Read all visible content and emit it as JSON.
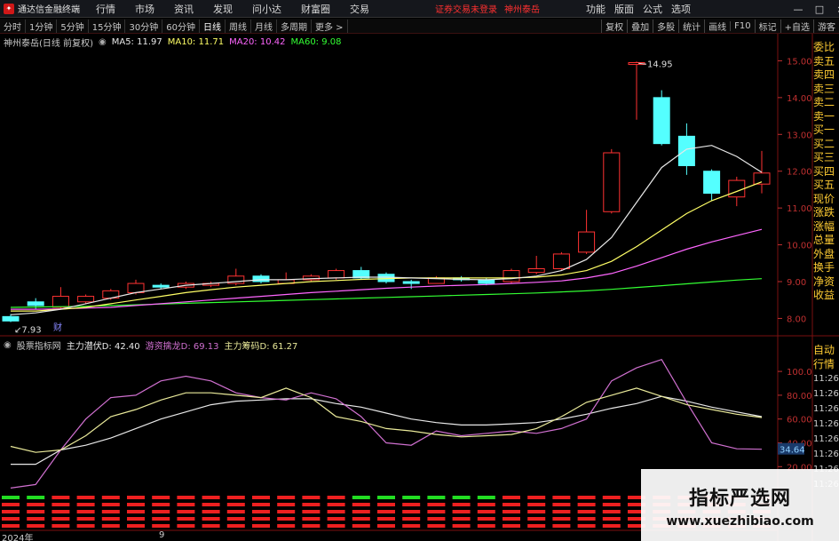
{
  "app": {
    "title": "通达信金融终端",
    "broker_status": "证券交易未登录",
    "stock_name": "神州泰岳"
  },
  "menu": [
    "行情",
    "市场",
    "资讯",
    "发现",
    "问小达",
    "财富圈",
    "交易"
  ],
  "right_menu": [
    "功能",
    "版面",
    "公式",
    "选项"
  ],
  "window_buttons": [
    "—",
    "□",
    "×"
  ],
  "corner_letter": "R",
  "periods": [
    "分时",
    "1分钟",
    "5分钟",
    "15分钟",
    "30分钟",
    "60分钟",
    "日线",
    "周线",
    "月线",
    "多周期",
    "更多 >"
  ],
  "active_period": "日线",
  "tools": [
    "复权",
    "叠加",
    "多股",
    "统计",
    "画线",
    "F10",
    "标记",
    "+自选",
    "游客"
  ],
  "kline_info": {
    "title": "神州泰岳(日线 前复权)",
    "ma5": "MA5: 11.97",
    "ma10": "MA10: 11.71",
    "ma20": "MA20: 10.42",
    "ma60": "MA60: 9.08"
  },
  "price_axis": [
    "15.00",
    "14.00",
    "13.00",
    "12.00",
    "11.00",
    "10.00",
    "9.00",
    "8.00"
  ],
  "high_label": "14.95",
  "low_label": "7.93",
  "finance_marker": "财",
  "indicator_info": {
    "title": "股票指标网",
    "line1": "主力潜伏D: 42.40",
    "line2": "游资擒龙D: 69.13",
    "line3": "主力筹码D: 61.27"
  },
  "indicator_axis": [
    "100.0",
    "80.00",
    "60.00",
    "40.00",
    "20.00"
  ],
  "indicator_current": "34.64",
  "sidebar": [
    "委比",
    "卖五",
    "卖四",
    "卖三",
    "卖二",
    "卖一",
    "买一",
    "买二",
    "买三",
    "买四",
    "买五",
    "现价",
    "涨跌",
    "涨幅",
    "总量",
    "外盘",
    "换手",
    "净资",
    "收益"
  ],
  "sidebar2": [
    "自动",
    "行情"
  ],
  "time_ticks": [
    "11:26",
    "11:26",
    "11:26",
    "11:26",
    "11:26",
    "11:26",
    "11:26",
    "11:26"
  ],
  "x_axis": {
    "year": "2024年",
    "month": "9"
  },
  "watermark": {
    "cn": "指标严选网",
    "url": "www.xuezhibiao.com"
  },
  "colors": {
    "up": "#ff3232",
    "down": "#54ffff",
    "ma5": "#e8e8e8",
    "ma10": "#ffff66",
    "ma20": "#ff66ff",
    "ma60": "#33ff33",
    "ind1": "#e8e8e8",
    "ind2": "#d070d0",
    "ind3": "#eaea9a"
  },
  "chart_data": [
    {
      "type": "candlestick",
      "ylim": [
        7.6,
        15.3
      ],
      "candles": [
        {
          "o": 8.05,
          "c": 7.93,
          "h": 8.12,
          "l": 7.9
        },
        {
          "o": 8.45,
          "c": 8.35,
          "h": 8.55,
          "l": 8.25
        },
        {
          "o": 8.3,
          "c": 8.6,
          "h": 8.85,
          "l": 8.25
        },
        {
          "o": 8.45,
          "c": 8.6,
          "h": 8.65,
          "l": 8.4
        },
        {
          "o": 8.55,
          "c": 8.75,
          "h": 8.8,
          "l": 8.5
        },
        {
          "o": 8.7,
          "c": 8.95,
          "h": 9.05,
          "l": 8.65
        },
        {
          "o": 8.9,
          "c": 8.85,
          "h": 8.95,
          "l": 8.8
        },
        {
          "o": 8.85,
          "c": 8.95,
          "h": 9.0,
          "l": 8.8
        },
        {
          "o": 8.9,
          "c": 8.95,
          "h": 9.0,
          "l": 8.85
        },
        {
          "o": 8.95,
          "c": 9.15,
          "h": 9.35,
          "l": 8.9
        },
        {
          "o": 9.15,
          "c": 9.0,
          "h": 9.2,
          "l": 8.95
        },
        {
          "o": 8.95,
          "c": 9.05,
          "h": 9.25,
          "l": 8.95
        },
        {
          "o": 9.05,
          "c": 9.15,
          "h": 9.2,
          "l": 9.0
        },
        {
          "o": 9.1,
          "c": 9.3,
          "h": 9.35,
          "l": 9.05
        },
        {
          "o": 9.3,
          "c": 9.1,
          "h": 9.4,
          "l": 9.05
        },
        {
          "o": 9.2,
          "c": 9.0,
          "h": 9.25,
          "l": 8.95
        },
        {
          "o": 9.0,
          "c": 8.95,
          "h": 9.05,
          "l": 8.8
        },
        {
          "o": 8.95,
          "c": 9.1,
          "h": 9.15,
          "l": 8.95
        },
        {
          "o": 9.1,
          "c": 9.05,
          "h": 9.15,
          "l": 9.0
        },
        {
          "o": 9.05,
          "c": 8.95,
          "h": 9.1,
          "l": 8.9
        },
        {
          "o": 9.0,
          "c": 9.3,
          "h": 9.35,
          "l": 8.95
        },
        {
          "o": 9.25,
          "c": 9.35,
          "h": 9.7,
          "l": 9.2
        },
        {
          "o": 9.35,
          "c": 9.75,
          "h": 9.8,
          "l": 9.3
        },
        {
          "o": 9.8,
          "c": 10.35,
          "h": 10.95,
          "l": 9.75
        },
        {
          "o": 10.9,
          "c": 12.5,
          "h": 12.6,
          "l": 10.85
        },
        {
          "o": 14.9,
          "c": 14.95,
          "h": 14.98,
          "l": 13.4
        },
        {
          "o": 14.0,
          "c": 12.75,
          "h": 14.2,
          "l": 12.7
        },
        {
          "o": 12.95,
          "c": 12.15,
          "h": 13.3,
          "l": 11.9
        },
        {
          "o": 12.0,
          "c": 11.4,
          "h": 12.05,
          "l": 11.2
        },
        {
          "o": 11.3,
          "c": 11.75,
          "h": 11.85,
          "l": 11.05
        },
        {
          "o": 11.65,
          "c": 11.95,
          "h": 12.55,
          "l": 11.4
        }
      ],
      "ma5": [
        8.1,
        8.15,
        8.25,
        8.4,
        8.55,
        8.7,
        8.8,
        8.9,
        8.95,
        9.0,
        9.05,
        9.05,
        9.08,
        9.1,
        9.12,
        9.12,
        9.1,
        9.08,
        9.06,
        9.05,
        9.08,
        9.15,
        9.3,
        9.6,
        10.2,
        11.15,
        12.1,
        12.6,
        12.7,
        12.4,
        11.97
      ],
      "ma10": [
        8.2,
        8.2,
        8.25,
        8.3,
        8.4,
        8.5,
        8.6,
        8.7,
        8.78,
        8.85,
        8.9,
        8.95,
        9.0,
        9.03,
        9.06,
        9.08,
        9.1,
        9.1,
        9.1,
        9.1,
        9.1,
        9.12,
        9.18,
        9.3,
        9.55,
        9.95,
        10.4,
        10.85,
        11.2,
        11.45,
        11.71
      ],
      "ma20": [
        8.25,
        8.25,
        8.26,
        8.28,
        8.3,
        8.35,
        8.4,
        8.45,
        8.5,
        8.55,
        8.6,
        8.65,
        8.7,
        8.74,
        8.78,
        8.82,
        8.85,
        8.88,
        8.9,
        8.92,
        8.95,
        8.98,
        9.02,
        9.1,
        9.22,
        9.42,
        9.65,
        9.88,
        10.08,
        10.25,
        10.42
      ],
      "ma60": [
        8.3,
        8.31,
        8.32,
        8.33,
        8.35,
        8.37,
        8.39,
        8.41,
        8.43,
        8.45,
        8.47,
        8.49,
        8.51,
        8.53,
        8.55,
        8.57,
        8.59,
        8.61,
        8.63,
        8.65,
        8.67,
        8.69,
        8.72,
        8.75,
        8.79,
        8.84,
        8.89,
        8.94,
        8.99,
        9.04,
        9.08
      ]
    },
    {
      "type": "line",
      "ylim": [
        15,
        115
      ],
      "series": [
        {
          "name": "主力潜伏D",
          "values": [
            22,
            22,
            34,
            38,
            44,
            52,
            60,
            66,
            72,
            75,
            76,
            77,
            77,
            73,
            70,
            65,
            60,
            57,
            55,
            55,
            56,
            57,
            60,
            64,
            69,
            73,
            79,
            75,
            70,
            66,
            62
          ]
        },
        {
          "name": "游资擒龙D",
          "values": [
            2,
            5,
            34,
            60,
            78,
            80,
            92,
            96,
            92,
            82,
            78,
            76,
            82,
            77,
            62,
            40,
            38,
            50,
            46,
            48,
            50,
            48,
            52,
            60,
            92,
            103,
            110,
            74,
            40,
            35,
            34.64
          ]
        },
        {
          "name": "主力筹码D",
          "values": [
            37,
            32,
            34,
            46,
            62,
            68,
            76,
            82,
            82,
            80,
            78,
            86,
            78,
            62,
            58,
            52,
            50,
            47,
            45,
            46,
            47,
            52,
            62,
            74,
            80,
            86,
            79,
            72,
            68,
            64,
            61.27
          ]
        }
      ]
    },
    {
      "type": "bar",
      "values": [
        1,
        1,
        0,
        0,
        0,
        0,
        0,
        0,
        0,
        0,
        0,
        0,
        0,
        0,
        1,
        1,
        1,
        1,
        1,
        1,
        0,
        0,
        0,
        0,
        0,
        0,
        0,
        0,
        0,
        0,
        0
      ]
    }
  ]
}
